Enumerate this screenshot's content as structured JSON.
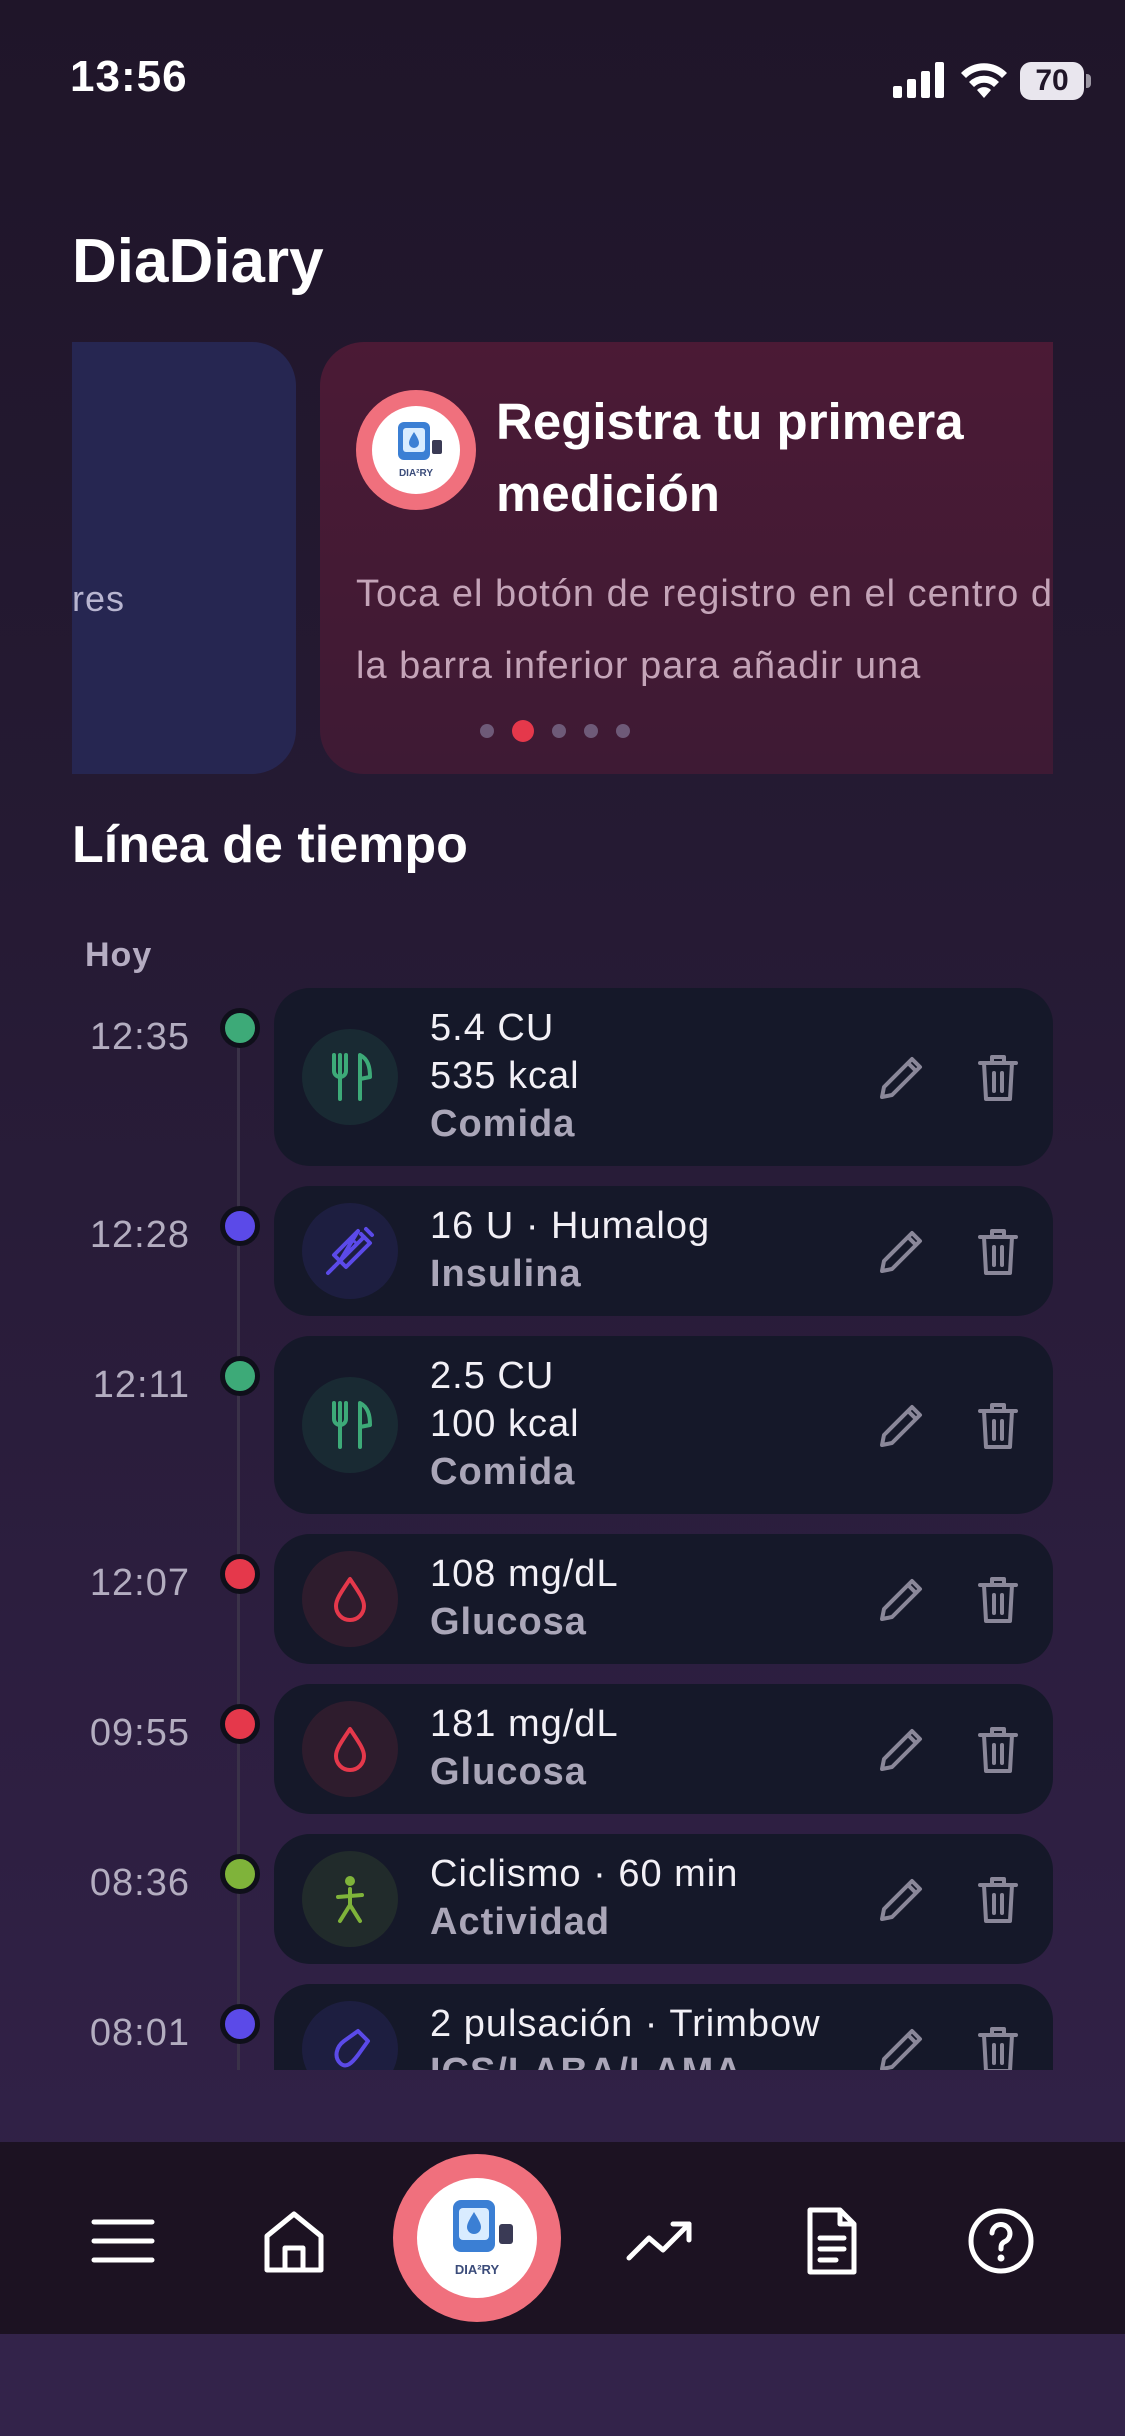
{
  "status_bar": {
    "time": "13:56",
    "battery": "70"
  },
  "app": {
    "title": "DiaDiary"
  },
  "carousel": {
    "prev_card_text": "res",
    "card": {
      "title": "Registra tu primera medición",
      "text": "Toca el botón de registro en el centro de la barra inferior para añadir una glucosa, una presión arterial, una comida y más.",
      "logo_text": "DIA²RY"
    },
    "page_count": 5,
    "active_page": 2
  },
  "timeline": {
    "title": "Línea de tiempo",
    "day_label": "Hoy",
    "entries": [
      {
        "time": "12:35",
        "lines": [
          "5.4 CU",
          "535 kcal"
        ],
        "type": "Comida",
        "icon": "fork-knife-icon",
        "color": "#3daa78"
      },
      {
        "time": "12:28",
        "lines": [
          "16 U · Humalog"
        ],
        "type": "Insulina",
        "icon": "syringe-icon",
        "color": "#5b4ae8"
      },
      {
        "time": "12:11",
        "lines": [
          "2.5 CU",
          "100 kcal"
        ],
        "type": "Comida",
        "icon": "fork-knife-icon",
        "color": "#3daa78"
      },
      {
        "time": "12:07",
        "lines": [
          "108 mg/dL"
        ],
        "type": "Glucosa",
        "icon": "blood-drop-icon",
        "color": "#e5384b"
      },
      {
        "time": "09:55",
        "lines": [
          "181 mg/dL"
        ],
        "type": "Glucosa",
        "icon": "blood-drop-icon",
        "color": "#e5384b"
      },
      {
        "time": "08:36",
        "lines": [
          "Ciclismo · 60 min"
        ],
        "type": "Actividad",
        "icon": "walking-person-icon",
        "color": "#7fb33a"
      },
      {
        "time": "08:01",
        "lines": [
          "2 pulsación · Trimbow"
        ],
        "type": "ICS/LABA/LAMA",
        "icon": "inhaler-icon",
        "color": "#5b4ae8"
      }
    ]
  },
  "bottom_nav": {
    "items": [
      "menu-icon",
      "home-icon",
      "record-button",
      "trend-chart-icon",
      "report-document-icon",
      "help-icon"
    ],
    "logo_text": "DIA²RY"
  },
  "colors": {
    "accent_pink": "#f0707d",
    "card_bg": "#151829",
    "nav_bg": "#1c1222"
  }
}
